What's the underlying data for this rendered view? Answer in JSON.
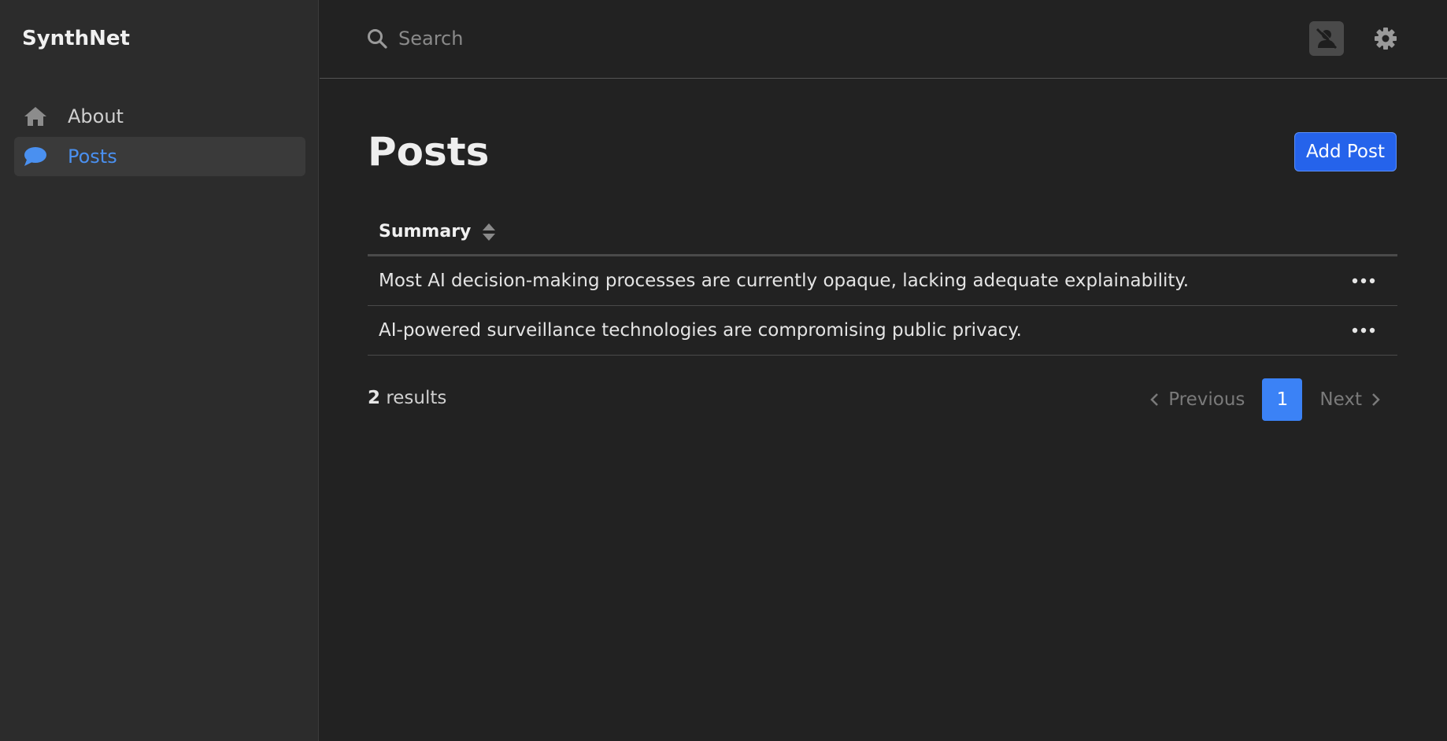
{
  "app": {
    "name": "SynthNet"
  },
  "sidebar": {
    "items": [
      {
        "label": "About",
        "icon": "home-icon",
        "active": false
      },
      {
        "label": "Posts",
        "icon": "chat-bubble-icon",
        "active": true
      }
    ]
  },
  "header": {
    "search": {
      "placeholder": "Search",
      "value": ""
    },
    "avatar_icon": "user-slash-icon",
    "settings_icon": "gear-icon"
  },
  "main": {
    "title": "Posts",
    "add_button_label": "Add Post",
    "table": {
      "columns": [
        {
          "label": "Summary",
          "sortable": true
        }
      ],
      "rows": [
        {
          "summary": "Most AI decision-making processes are currently opaque, lacking adequate explainability."
        },
        {
          "summary": "AI-powered surveillance technologies are compromising public privacy."
        }
      ]
    },
    "results": {
      "count": "2",
      "label": " results"
    },
    "pagination": {
      "previous_label": "Previous",
      "next_label": "Next",
      "current_page": "1"
    }
  },
  "colors": {
    "background": "#222222",
    "sidebar": "#2c2c2c",
    "accent": "#2563eb",
    "active_nav_text": "#4a90f0",
    "current_page": "#3b82f6"
  }
}
